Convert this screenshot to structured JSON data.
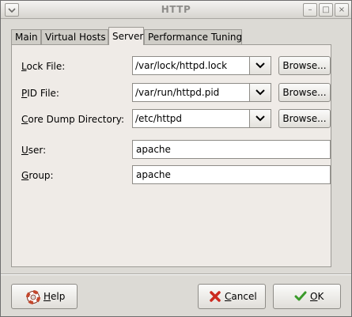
{
  "window": {
    "title": "HTTP"
  },
  "titlebar_buttons": [
    {
      "name": "minimize-icon",
      "glyph": "–"
    },
    {
      "name": "maximize-icon",
      "glyph": "□"
    },
    {
      "name": "close-icon",
      "glyph": "×"
    }
  ],
  "tabs": [
    {
      "label": "Main",
      "active": false
    },
    {
      "label": "Virtual Hosts",
      "active": false
    },
    {
      "label": "Server",
      "active": true
    },
    {
      "label": "Performance Tuning",
      "active": false
    }
  ],
  "form": {
    "lock_file": {
      "label_first": "L",
      "label_rest": "ock File:",
      "value": "/var/lock/httpd.lock"
    },
    "pid_file": {
      "label_first": "P",
      "label_rest": "ID File:",
      "value": "/var/run/httpd.pid"
    },
    "core_dump": {
      "label_first": "C",
      "label_rest": "ore Dump Directory:",
      "value": "/etc/httpd"
    },
    "browse_label": "Browse...",
    "user": {
      "label_first": "U",
      "label_rest": "ser:",
      "value": "apache"
    },
    "group": {
      "label_first": "G",
      "label_rest": "roup:",
      "value": "apache"
    }
  },
  "footer": {
    "help": {
      "first": "H",
      "rest": "elp"
    },
    "cancel": {
      "first": "C",
      "rest": "ancel"
    },
    "ok": {
      "first": "O",
      "rest": "K"
    }
  },
  "colors": {
    "cancel_icon": "#cc2a1f",
    "ok_icon": "#3a9a2a",
    "help_icon": "#c3462b"
  }
}
